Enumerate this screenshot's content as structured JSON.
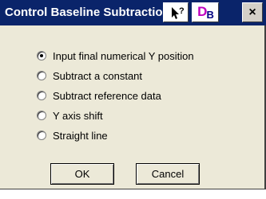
{
  "window": {
    "title": "Control Baseline Subtraction",
    "db_button_main": "D",
    "db_button_sub": "B",
    "close_glyph": "×"
  },
  "options": [
    {
      "label": "Input final numerical Y position",
      "selected": true
    },
    {
      "label": "Subtract a constant",
      "selected": false
    },
    {
      "label": "Subtract reference data",
      "selected": false
    },
    {
      "label": "Y axis shift",
      "selected": false
    },
    {
      "label": "Straight line",
      "selected": false
    }
  ],
  "buttons": {
    "ok_label": "OK",
    "cancel_label": "Cancel"
  },
  "colors": {
    "titlebar": "#0a246a",
    "dialog_bg": "#ece9d8",
    "db_accent": "#c000c0"
  },
  "icons": [
    "help-pointer-icon",
    "db-icon",
    "close-icon",
    "radio-icon"
  ]
}
